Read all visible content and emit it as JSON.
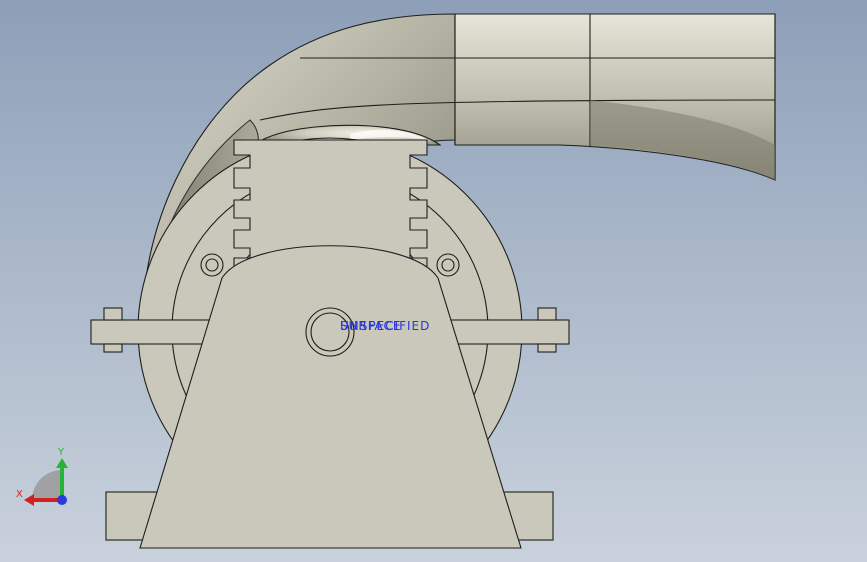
{
  "app": {
    "view": "Front",
    "background_top": "#8d9fb8",
    "background_bottom": "#c9d1dc"
  },
  "model": {
    "part_fill": "#c9c8ba",
    "edge_color": "#1e1e1e",
    "overlay_labels": [
      "SURFACE",
      "UNSPECIFIED"
    ],
    "overlay_color": "#2a35d8"
  },
  "triad": {
    "x_label": "X",
    "y_label": "Y",
    "x_color": "#d21f1f",
    "y_color": "#27b33a",
    "z_color": "#2a3bd6"
  }
}
